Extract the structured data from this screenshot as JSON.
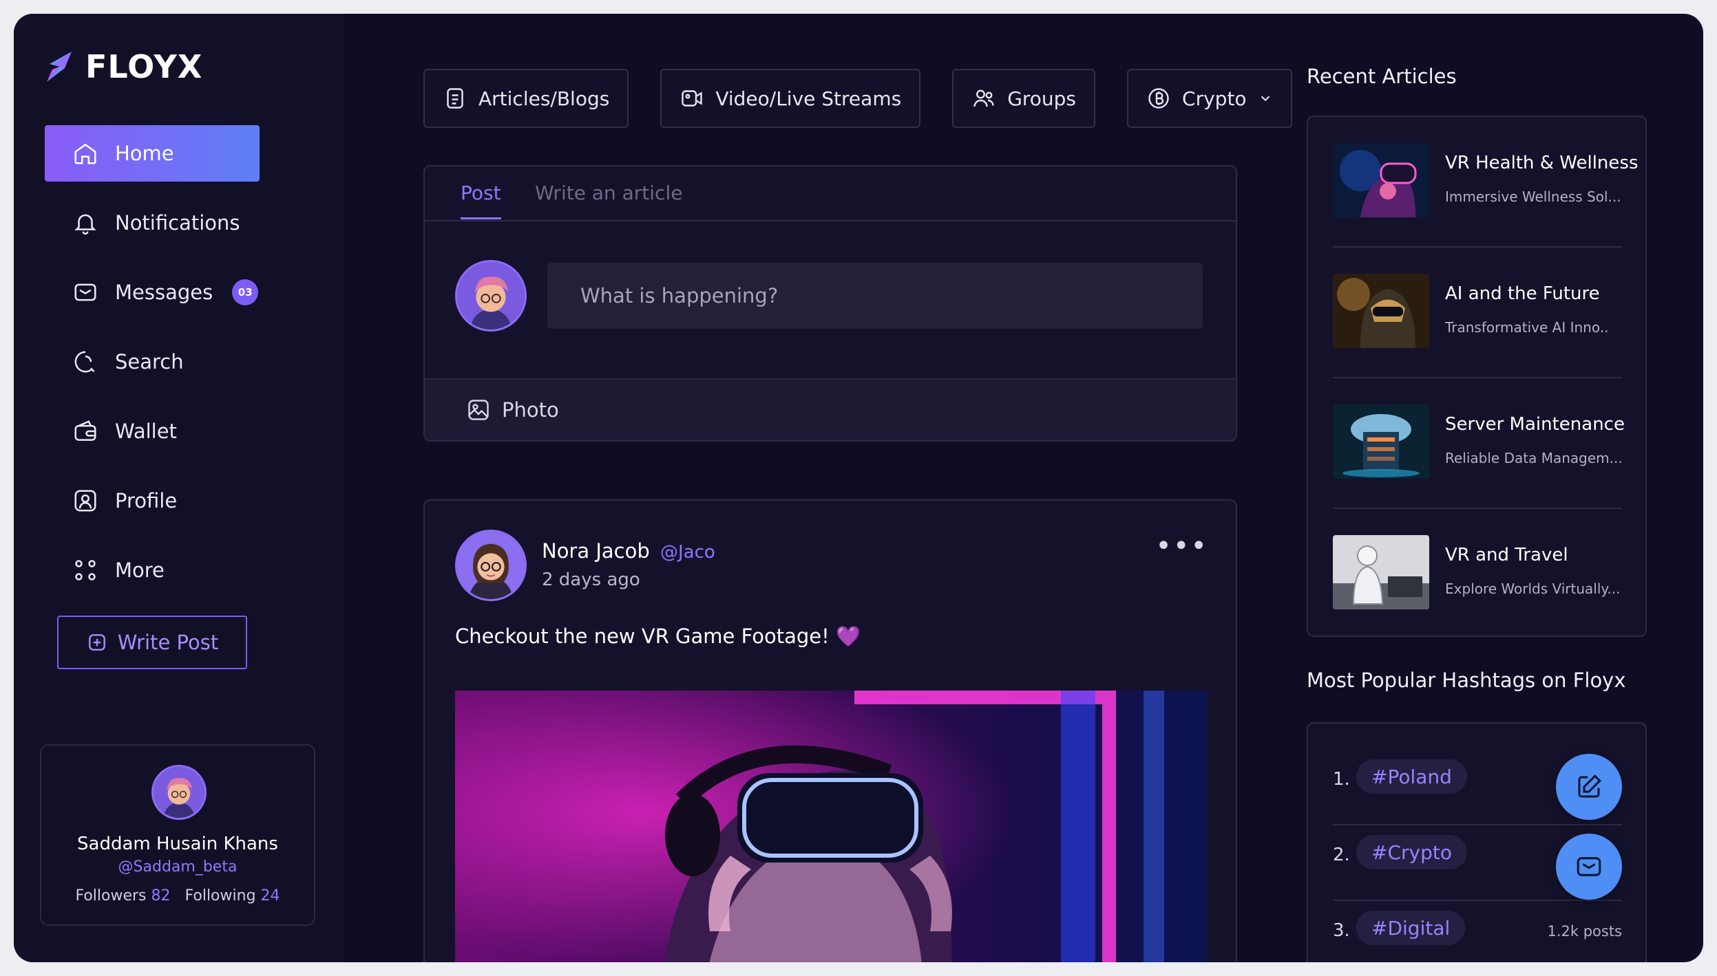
{
  "app": {
    "name": "FLOYX"
  },
  "sidebar": {
    "items": [
      {
        "label": "Home",
        "icon": "home-icon",
        "active": true
      },
      {
        "label": "Notifications",
        "icon": "bell-icon"
      },
      {
        "label": "Messages",
        "icon": "mail-icon",
        "badge": "03"
      },
      {
        "label": "Search",
        "icon": "search-icon"
      },
      {
        "label": "Wallet",
        "icon": "wallet-icon"
      },
      {
        "label": "Profile",
        "icon": "user-icon"
      },
      {
        "label": "More",
        "icon": "grid-dots-icon"
      }
    ],
    "write_post_label": "Write Post"
  },
  "profile": {
    "name": "Saddam Husain Khans",
    "handle": "@Saddam_beta",
    "followers_label": "Followers",
    "followers": "82",
    "following_label": "Following",
    "following": "24"
  },
  "filters": [
    {
      "label": "Articles/Blogs",
      "icon": "document-icon"
    },
    {
      "label": "Video/Live Streams",
      "icon": "video-icon"
    },
    {
      "label": "Groups",
      "icon": "users-icon"
    },
    {
      "label": "Crypto",
      "icon": "bitcoin-icon",
      "dropdown": true
    }
  ],
  "composer": {
    "tabs": [
      {
        "label": "Post",
        "active": true
      },
      {
        "label": "Write an article"
      }
    ],
    "placeholder": "What is happening?",
    "photo_label": "Photo"
  },
  "post": {
    "author": "Nora Jacob",
    "handle": "@Jaco",
    "time": "2 days ago",
    "text": "Checkout the new VR Game Footage!",
    "emoji": "💜"
  },
  "recent_articles": {
    "title": "Recent Articles",
    "items": [
      {
        "title": "VR Health & Wellness",
        "subtitle": "Immersive Wellness Sol..."
      },
      {
        "title": "AI and the Future",
        "subtitle": "Transformative AI Inno.."
      },
      {
        "title": "Server Maintenance",
        "subtitle": "Reliable Data Managem..."
      },
      {
        "title": "VR and Travel",
        "subtitle": "Explore Worlds Virtually..."
      }
    ]
  },
  "hashtags": {
    "title": "Most Popular Hashtags on Floyx",
    "items": [
      {
        "rank": "1.",
        "tag": "#Poland",
        "count": ""
      },
      {
        "rank": "2.",
        "tag": "#Crypto",
        "count": ""
      },
      {
        "rank": "3.",
        "tag": "#Digital",
        "count": "1.2k posts"
      }
    ]
  },
  "colors": {
    "accent": "#8a5cf6",
    "accent_blue": "#5f7ff7",
    "background": "#0f0d23",
    "fab": "#4f8ff5"
  }
}
